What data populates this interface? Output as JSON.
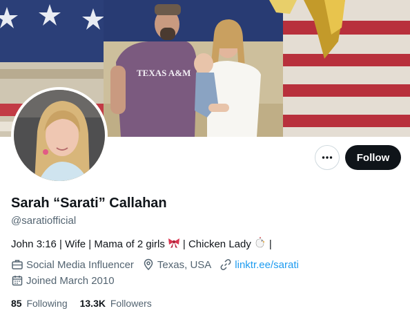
{
  "profile": {
    "display_name": "Sarah “Sarati” Callahan",
    "handle": "@saratiofficial",
    "bio": {
      "part1": "John 3:16 | Wife | Mama of 2 girls",
      "emoji1": "bow-emoji",
      "part2": "| Chicken Lady",
      "emoji2": "chicken-emoji",
      "part3": "|"
    },
    "category": "Social Media Influencer",
    "location": "Texas, USA",
    "website": "linktr.ee/sarati",
    "joined": "Joined March 2010"
  },
  "stats": {
    "following_count": "85",
    "following_label": "Following",
    "followers_count": "13.3K",
    "followers_label": "Followers"
  },
  "actions": {
    "more_icon": "more-horizontal-icon",
    "follow_label": "Follow"
  },
  "banner": {
    "shirt_text": "TEXAS A&M"
  },
  "colors": {
    "accent": "#1d9bf0",
    "follow_bg": "#0f1419",
    "secondary_text": "#536471",
    "shirt": "#7b5a7f"
  }
}
